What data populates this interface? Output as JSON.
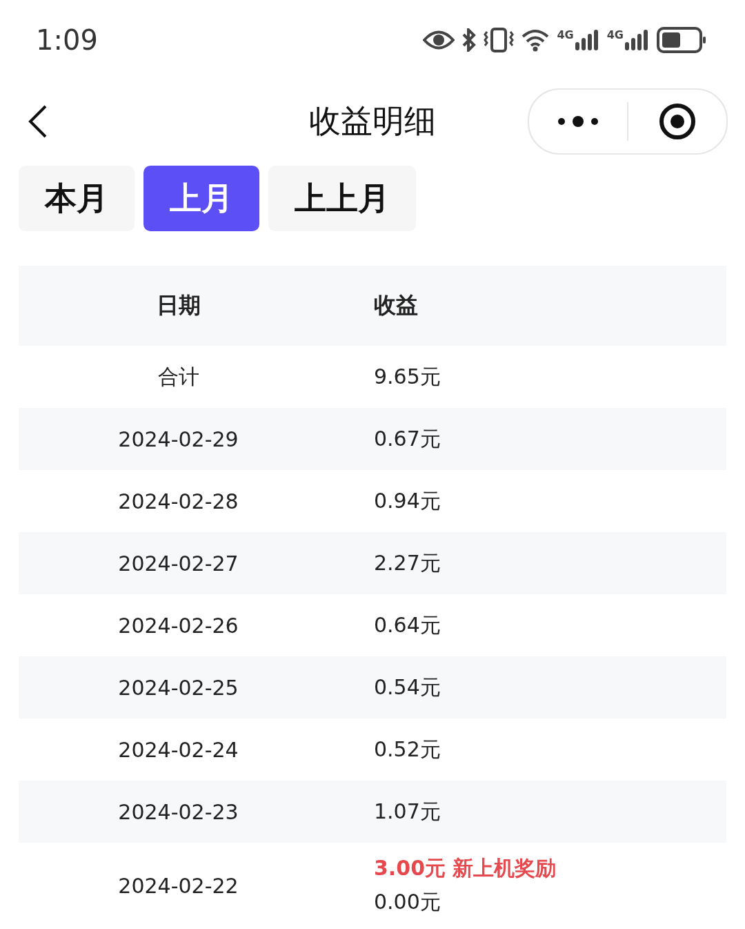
{
  "status_bar": {
    "time": "1:09",
    "networks": [
      "4G",
      "4G"
    ]
  },
  "header": {
    "title": "收益明细"
  },
  "tabs": [
    {
      "label": "本月",
      "selected": false
    },
    {
      "label": "上月",
      "selected": true
    },
    {
      "label": "上上月",
      "selected": false
    }
  ],
  "table": {
    "columns": [
      "日期",
      "收益"
    ],
    "rows": [
      {
        "date": "合计",
        "amount": "9.65元"
      },
      {
        "date": "2024-02-29",
        "amount": "0.67元"
      },
      {
        "date": "2024-02-28",
        "amount": "0.94元"
      },
      {
        "date": "2024-02-27",
        "amount": "2.27元"
      },
      {
        "date": "2024-02-26",
        "amount": "0.64元"
      },
      {
        "date": "2024-02-25",
        "amount": "0.54元"
      },
      {
        "date": "2024-02-24",
        "amount": "0.52元"
      },
      {
        "date": "2024-02-23",
        "amount": "1.07元"
      },
      {
        "date": "2024-02-22",
        "bonus": "3.00元 新上机奖励",
        "amount": "0.00元"
      }
    ]
  }
}
